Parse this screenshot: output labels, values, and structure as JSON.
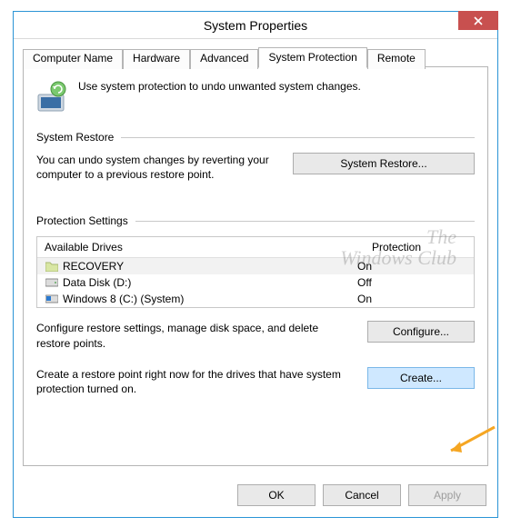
{
  "window": {
    "title": "System Properties"
  },
  "tabs": {
    "items": [
      {
        "label": "Computer Name"
      },
      {
        "label": "Hardware"
      },
      {
        "label": "Advanced"
      },
      {
        "label": "System Protection"
      },
      {
        "label": "Remote"
      }
    ]
  },
  "intro": {
    "text": "Use system protection to undo unwanted system changes."
  },
  "system_restore": {
    "header": "System Restore",
    "text": "You can undo system changes by reverting your computer to a previous restore point.",
    "button": "System Restore..."
  },
  "protection": {
    "header": "Protection Settings",
    "table_headers": {
      "drives": "Available Drives",
      "protection": "Protection"
    },
    "drives": [
      {
        "icon": "folder",
        "name": "RECOVERY",
        "status": "On"
      },
      {
        "icon": "disk",
        "name": "Data Disk (D:)",
        "status": "Off"
      },
      {
        "icon": "windisk",
        "name": "Windows 8 (C:) (System)",
        "status": "On"
      }
    ],
    "configure_text": "Configure restore settings, manage disk space, and delete restore points.",
    "configure_button": "Configure...",
    "create_text": "Create a restore point right now for the drives that have system protection turned on.",
    "create_button": "Create..."
  },
  "buttons": {
    "ok": "OK",
    "cancel": "Cancel",
    "apply": "Apply"
  },
  "watermark": {
    "line1": "The",
    "line2": "Windows Club"
  }
}
